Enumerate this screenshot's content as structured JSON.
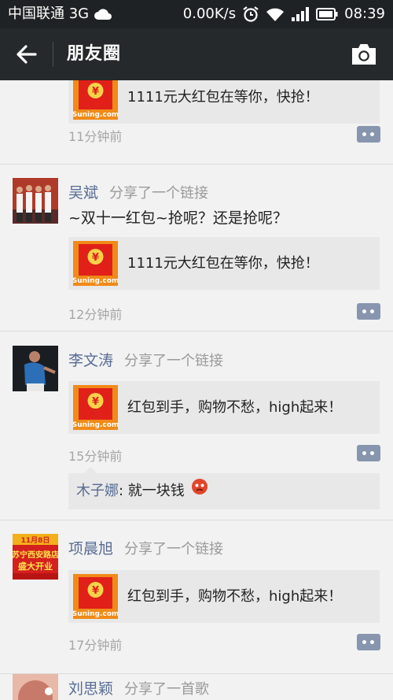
{
  "status_bar": {
    "carrier": "中国联通 3G",
    "speed": "0.00K/s",
    "time": "08:39",
    "icons": [
      "cloud-icon",
      "alarm-icon",
      "wifi-icon",
      "signal-icon",
      "battery-icon"
    ]
  },
  "header": {
    "title": "朋友圈",
    "back_icon": "back-arrow-icon",
    "camera_icon": "camera-icon"
  },
  "colors": {
    "status_bg": "#1f2224",
    "header_bg": "#25292b",
    "feed_bg": "#f2f2f2",
    "name_color": "#586c94",
    "card_bg": "#e8e8e8",
    "comment_btn": "#8796ae",
    "red_envelope": "#e02019"
  },
  "posts": [
    {
      "card_title": "1111元大红包在等你，快抢！",
      "timestamp": "11分钟前"
    },
    {
      "author": "吴斌",
      "action": "分享了一个链接",
      "text": "~双十一红包~抢呢？还是抢呢？",
      "card_title": "1111元大红包在等你，快抢！",
      "timestamp": "12分钟前"
    },
    {
      "author": "李文涛",
      "action": "分享了一个链接",
      "card_title": "红包到手，购物不愁，high起来！",
      "timestamp": "15分钟前",
      "comment": {
        "name": "木子娜",
        "sep": ":",
        "text": " 就一块钱"
      }
    },
    {
      "author": "项晨旭",
      "action": "分享了一个链接",
      "avatar_banner": {
        "top": "11月8日",
        "line1": "苏宁西安路店",
        "line2": "盛大开业"
      },
      "card_title": "红包到手，购物不愁，high起来！",
      "timestamp": "17分钟前"
    },
    {
      "author": "刘思颖",
      "action": "分享了一首歌"
    }
  ],
  "thumb": {
    "symbol": "¥",
    "brand": "Suning.com"
  }
}
